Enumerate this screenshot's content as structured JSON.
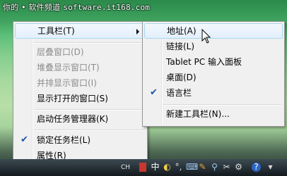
{
  "watermark": {
    "site": "你的 • 软件频道",
    "url": "software.it168.com"
  },
  "context_menu": {
    "toolbars": "工具栏(T)",
    "cascade": "层叠窗口(D)",
    "stack": "堆叠显示窗口(T)",
    "side_by_side": "并排显示窗口(I)",
    "show_desktop": "显示打开的窗口(S)",
    "task_manager": "启动任务管理器(K)",
    "lock_taskbar": "锁定任务栏(L)",
    "properties": "属性(R)"
  },
  "toolbar_submenu": {
    "address": "地址(A)",
    "links": "链接(L)",
    "tablet_input": "Tablet PC 输入面板",
    "desktop": "桌面(D)",
    "language_bar": "语言栏",
    "new_toolbar": "新建工具栏(N)..."
  },
  "taskbar": {
    "tray_label": "CH",
    "ime_char": "中"
  },
  "icons": {
    "submenu_arrow": "triangle-right",
    "check": "checkmark",
    "cursor": "mouse-pointer-arrow"
  }
}
